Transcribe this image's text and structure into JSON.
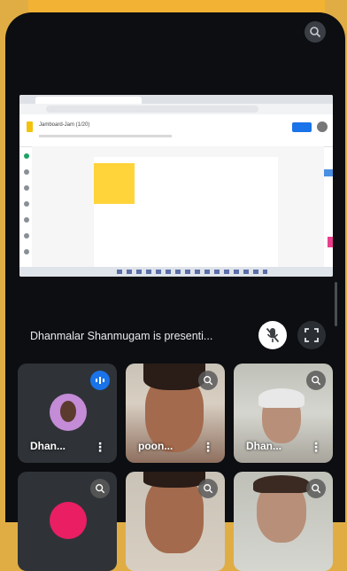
{
  "presentation": {
    "status_text": "Dhanmalar Shanmugam is presenti...",
    "doc_title": "Jamboard-Jam (1/20)"
  },
  "participants": [
    {
      "name": "Dhan...",
      "speaking": true,
      "camera_on": false
    },
    {
      "name": "poon...",
      "speaking": false,
      "camera_on": true
    },
    {
      "name": "Dhan...",
      "speaking": false,
      "camera_on": true
    },
    {
      "name": "",
      "speaking": false,
      "camera_on": false
    },
    {
      "name": "",
      "speaking": false,
      "camera_on": true
    },
    {
      "name": "",
      "speaking": false,
      "camera_on": true
    }
  ],
  "icons": {
    "top_right": "zoom-icon",
    "mic_button": "mic-off-icon",
    "fullscreen_button": "fullscreen-icon",
    "more": "⋮"
  },
  "colors": {
    "background": "#0c0e11",
    "frame": "#e0ad45",
    "accent_blue": "#1a73e8"
  }
}
